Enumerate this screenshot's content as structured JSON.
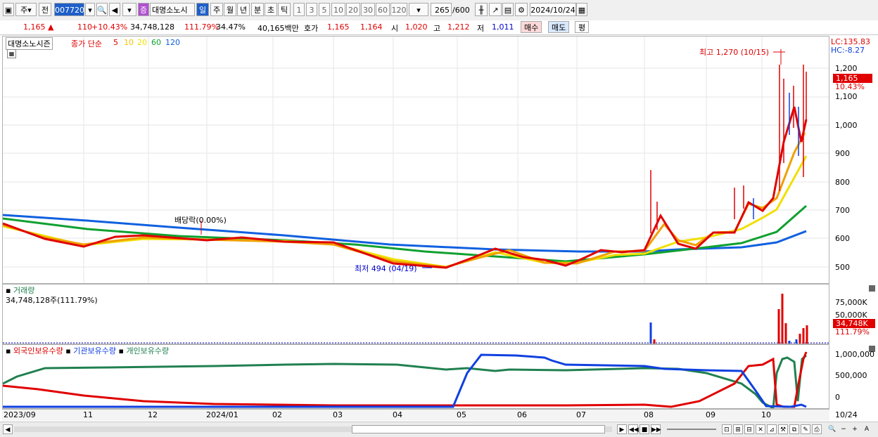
{
  "toolbar": {
    "period_sel": "주",
    "prev_label": "전",
    "code": "007720",
    "stock_badge": "증",
    "stock_name": "대명소노시",
    "periods": [
      "일",
      "주",
      "월",
      "년",
      "분",
      "초",
      "틱"
    ],
    "nums": [
      "1",
      "3",
      "5",
      "10",
      "20",
      "30",
      "60",
      "120"
    ],
    "count": "265",
    "total": "/600",
    "date": "2024/10/24"
  },
  "quote": {
    "price": "1,165 ▲",
    "change": "110",
    "rate": "+10.43%",
    "volume": "34,748,128",
    "vol_ratio": "111.79%",
    "turnover": "34.47%",
    "amount": "40,165백만",
    "bid_label": "호가",
    "ask": "1,165",
    "bid": "1,164",
    "open_label": "시",
    "open": "1,020",
    "high_label": "고",
    "high": "1,212",
    "low_label": "저",
    "low": "1,011",
    "buy": "매수",
    "sell": "매도",
    "eval": "평"
  },
  "main": {
    "legend_name": "대명소노시즌",
    "legend_close": "종가 단순",
    "ma": [
      {
        "label": "5",
        "color": "#e00000"
      },
      {
        "label": "10",
        "color": "#f5c400"
      },
      {
        "label": "20",
        "color": "#f0e000"
      },
      {
        "label": "60",
        "color": "#10a030"
      },
      {
        "label": "120",
        "color": "#1060e0"
      }
    ],
    "high_note": "최고 1,270 (10/15)",
    "low_note": "최저 494 (04/19)",
    "div_note": "배당락(0.00%)",
    "lc": "LC:135.83",
    "hc": "HC:-8.27",
    "yticks": [
      "1,200",
      "1,100",
      "1,000",
      "900",
      "800",
      "700",
      "600",
      "500"
    ],
    "price_tag": "1,165",
    "rate_tag": "10.43%"
  },
  "volume": {
    "title": "거래량",
    "value": "34,748,128주(111.79%)",
    "yticks": [
      "75,000K",
      "50,000K"
    ],
    "tag": "34,748K",
    "tag2": "111.79%"
  },
  "holdings": {
    "legend": [
      "외국인보유수량",
      "기관보유수량",
      "개인보유수량"
    ],
    "colors": [
      "#e00000",
      "#1040e0",
      "#208050"
    ],
    "yticks": [
      "1,000,000",
      "500,000",
      "0"
    ]
  },
  "xaxis": [
    "2023/09",
    "11",
    "12",
    "2024/01",
    "02",
    "03",
    "04",
    "05",
    "06",
    "07",
    "08",
    "09",
    "10",
    "10/24"
  ]
}
